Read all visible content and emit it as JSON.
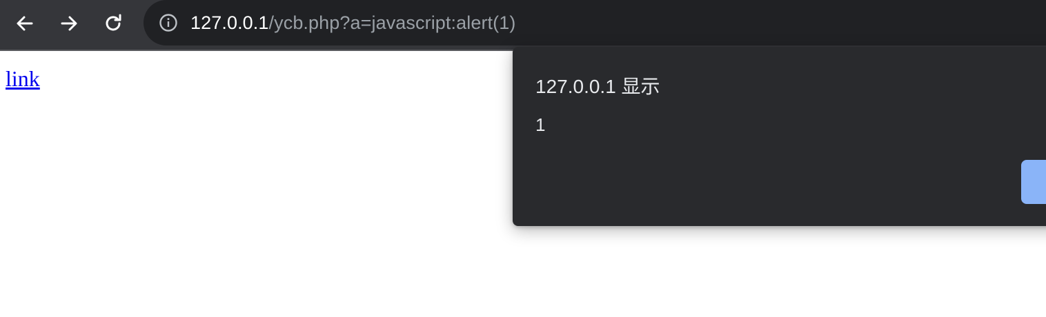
{
  "browser": {
    "nav": {
      "back_icon": "arrow-left-icon",
      "forward_icon": "arrow-right-icon",
      "reload_icon": "reload-icon"
    },
    "address_bar": {
      "site_info_icon": "info-circle-icon",
      "url_host": "127.0.0.1",
      "url_rest": "/ycb.php?a=javascript:alert(1)"
    },
    "colors": {
      "toolbar_bg": "#35363a",
      "omnibox_bg": "#202124",
      "dialog_bg": "#292a2d",
      "button_accent": "#8ab4f8"
    }
  },
  "page": {
    "link_text": "link"
  },
  "alert_dialog": {
    "title": "127.0.0.1 显示",
    "message": "1",
    "ok_button_label": ""
  }
}
